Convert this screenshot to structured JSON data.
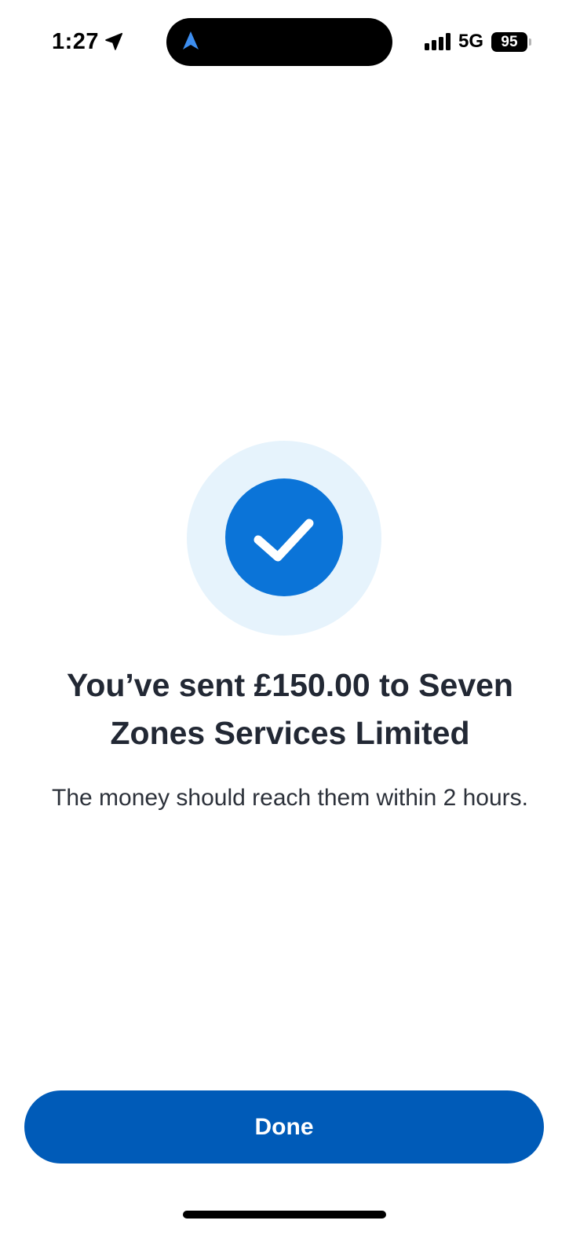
{
  "status_bar": {
    "time": "1:27",
    "network": "5G",
    "battery_level": "95",
    "signal_bars": 4,
    "location_icon": "location-arrow-icon",
    "island_icon": "navigation-arrow-icon",
    "island_icon_color": "#3d8ef0"
  },
  "confirmation": {
    "headline": "You’ve sent £150.00 to Seven Zones Services Limited",
    "message": "The money should reach them within 2 hours.",
    "icon": "checkmark-icon",
    "icon_color": "#0b74d8",
    "icon_ring_color": "#e6f3fc"
  },
  "actions": {
    "done_label": "Done",
    "button_color": "#005bb8"
  }
}
